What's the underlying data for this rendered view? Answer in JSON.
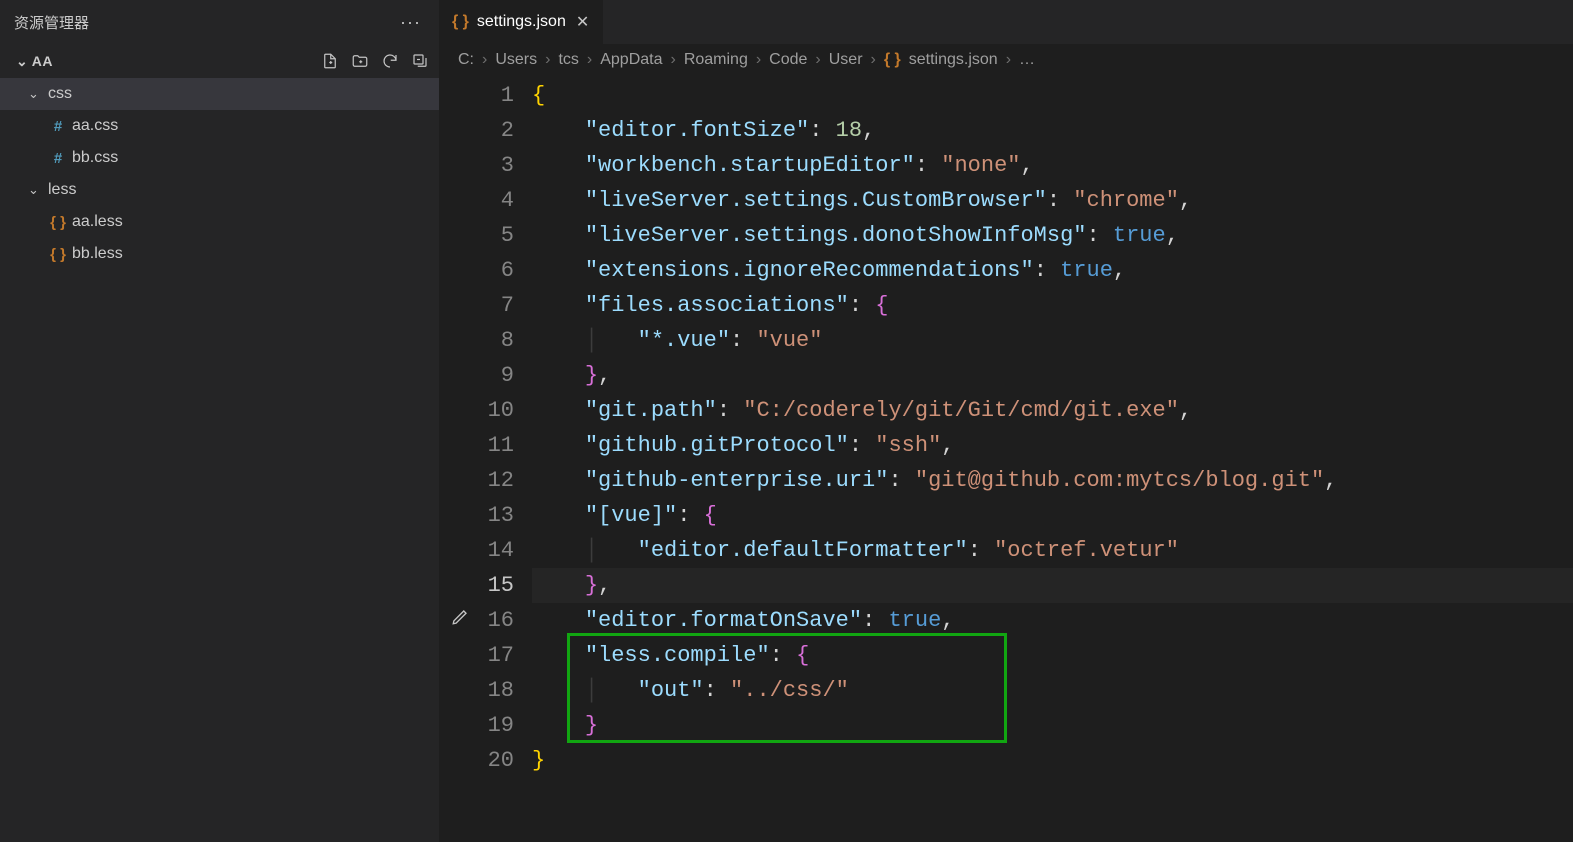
{
  "sidebar": {
    "title": "资源管理器",
    "project": "AA",
    "actions": {
      "newFile": "New File",
      "newFolder": "New Folder",
      "refresh": "Refresh",
      "collapse": "Collapse"
    },
    "tree": {
      "folder1": "css",
      "file1": "aa.css",
      "file2": "bb.css",
      "folder2": "less",
      "file3": "aa.less",
      "file4": "bb.less"
    }
  },
  "icons": {
    "hash": "#",
    "braces": "{ }",
    "ellipsis": "···",
    "chevronDown": "⌄",
    "close": "✕",
    "sep": "›",
    "dots": "…"
  },
  "tab": {
    "label": "settings.json"
  },
  "breadcrumbs": {
    "c": "C:",
    "users": "Users",
    "tcs": "tcs",
    "appdata": "AppData",
    "roaming": "Roaming",
    "code": "Code",
    "user": "User",
    "file": "settings.json"
  },
  "line_numbers": {
    "l1": "1",
    "l2": "2",
    "l3": "3",
    "l4": "4",
    "l5": "5",
    "l6": "6",
    "l7": "7",
    "l8": "8",
    "l9": "9",
    "l10": "10",
    "l11": "11",
    "l12": "12",
    "l13": "13",
    "l14": "14",
    "l15": "15",
    "l16": "16",
    "l17": "17",
    "l18": "18",
    "l19": "19",
    "l20": "20"
  },
  "code": {
    "k_fontSize": "\"editor.fontSize\"",
    "v_fontSize": "18",
    "k_startup": "\"workbench.startupEditor\"",
    "v_startup": "\"none\"",
    "k_browser": "\"liveServer.settings.CustomBrowser\"",
    "v_browser": "\"chrome\"",
    "k_info": "\"liveServer.settings.donotShowInfoMsg\"",
    "v_true": "true",
    "k_ext": "\"extensions.ignoreRecommendations\"",
    "k_files": "\"files.associations\"",
    "k_vueGlob": "\"*.vue\"",
    "v_vue": "\"vue\"",
    "k_gitpath": "\"git.path\"",
    "v_gitpath": "\"C:/coderely/git/Git/cmd/git.exe\"",
    "k_proto": "\"github.gitProtocol\"",
    "v_proto": "\"ssh\"",
    "k_enturi": "\"github-enterprise.uri\"",
    "v_enturi": "\"git@github.com:mytcs/blog.git\"",
    "k_vueSect": "\"[vue]\"",
    "k_formatter": "\"editor.defaultFormatter\"",
    "v_formatter": "\"octref.vetur\"",
    "k_formatOnSave": "\"editor.formatOnSave\"",
    "k_lessCompile": "\"less.compile\"",
    "k_out": "\"out\"",
    "v_out": "\"../css/\"",
    "guide": "│"
  }
}
